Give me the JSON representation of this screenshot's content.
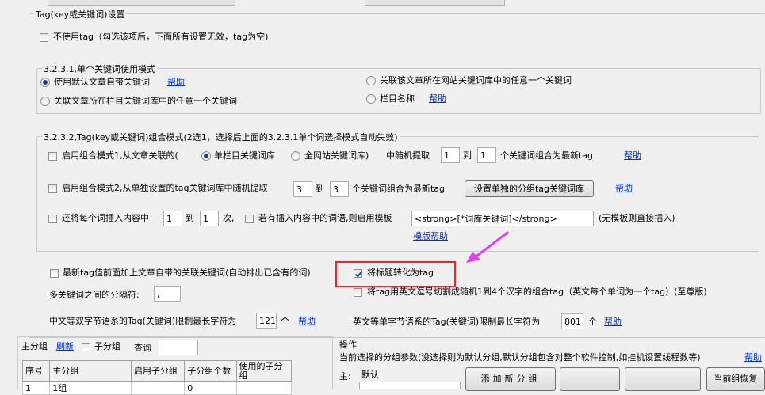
{
  "tag_group": {
    "title": "Tag(key或关键词)设置",
    "no_tag_label": "不使用tag（勾选该项后，下面所有设置无效，tag为空)",
    "no_tag_checked": false
  },
  "single_mode": {
    "title": "3.2.3.1,单个关键词使用模式",
    "opt_default": "使用默认文章自带关键词",
    "opt_default_help": "帮助",
    "opt_column_lib": "关联文章所在栏目关键词库中的任意一个关键词",
    "opt_site_lib": "关联该文章所在网站关键词库中的任意一个关键词",
    "opt_column_name": "栏目名称",
    "opt_column_name_help": "帮助",
    "selected": "opt_default"
  },
  "combo_mode": {
    "title": "3.2.3.2,Tag(key或关键词)组合模式(2选1，选择后上面的3.2.3.1单个词选择模式自动失效)",
    "mode1_label": "启用组合模式1,从文章关联的(",
    "mode1_radio_column": "单栏目关键词库",
    "mode1_radio_site": "全网站关键词库)",
    "mode1_selected": "column",
    "mode1_random": "中随机提取",
    "mode1_min": "1",
    "mode1_to": "到",
    "mode1_max": "1",
    "mode1_suffix": "个关键词组合为最新tag",
    "mode1_help": "帮助",
    "mode1_checked": false,
    "mode2_label": "启用组合模式2,从单独设置的tag关键词库中随机提取",
    "mode2_min": "3",
    "mode2_to": "到",
    "mode2_max": "3",
    "mode2_suffix": "个关键词组合为最新tag",
    "mode2_button": "设置单独的分组tag关键词库",
    "mode2_help": "帮助",
    "mode2_checked": false,
    "insert_label": "还将每个词插入内容中",
    "insert_min": "1",
    "insert_to": "到",
    "insert_max": "1",
    "insert_times": "次,",
    "insert_checked": false,
    "template_label": "若有插入内容中的词语,则启用模板",
    "template_value": "<strong>[*词库关键词]</strong>",
    "template_note": "(无模板则直接插入)",
    "template_checked": false,
    "template_help": "模版帮助"
  },
  "extra": {
    "prepend_label": "最新tag值前面加上文章自带的关联关键词(自动排出已含有的词)",
    "prepend_checked": false,
    "title_to_tag_label": "将标题转化为tag",
    "title_to_tag_checked": true,
    "english_split_label": "将tag用英文逗号切割成随机1到4个汉字的组合tag（英文每个单词为一个tag）(至尊版)",
    "english_split_checked": false,
    "separator_label": "多关键词之间的分隔符:",
    "separator_value": ",",
    "cn_limit_label": "中文等双字节语系的Tag(关键词)限制最长字符为",
    "cn_limit_value": "121",
    "cn_limit_unit": "个",
    "cn_limit_help": "帮助",
    "en_limit_label": "英文等单字节语系的Tag(关键词)限制最长字符为",
    "en_limit_value": "801",
    "en_limit_unit": "个",
    "en_limit_help": "帮助"
  },
  "bottom_left": {
    "main_group_label": "主分组",
    "refresh_link": "刷新",
    "sub_group_label": "子分组",
    "query_label": "查询",
    "query_value": "",
    "columns": [
      "序号",
      "主分组",
      "启用子分组",
      "子分组个数",
      "使用的子分组"
    ],
    "rows": [
      [
        "1",
        "1组",
        "",
        "0",
        ""
      ]
    ]
  },
  "bottom_right": {
    "title": "操作",
    "params_text": "当前选择的分组参数(没选择则为默认分组,默认分组包含对整个软件控制,如挂机设置线程数等)",
    "help": "帮助",
    "main_label": "主:",
    "main_value": "默认",
    "add_button": "添加新分组",
    "restore_button": "当前组恢复"
  },
  "colors": {
    "highlight": "#e8282c",
    "arrow": "#e040e8",
    "link": "#0033cc"
  }
}
